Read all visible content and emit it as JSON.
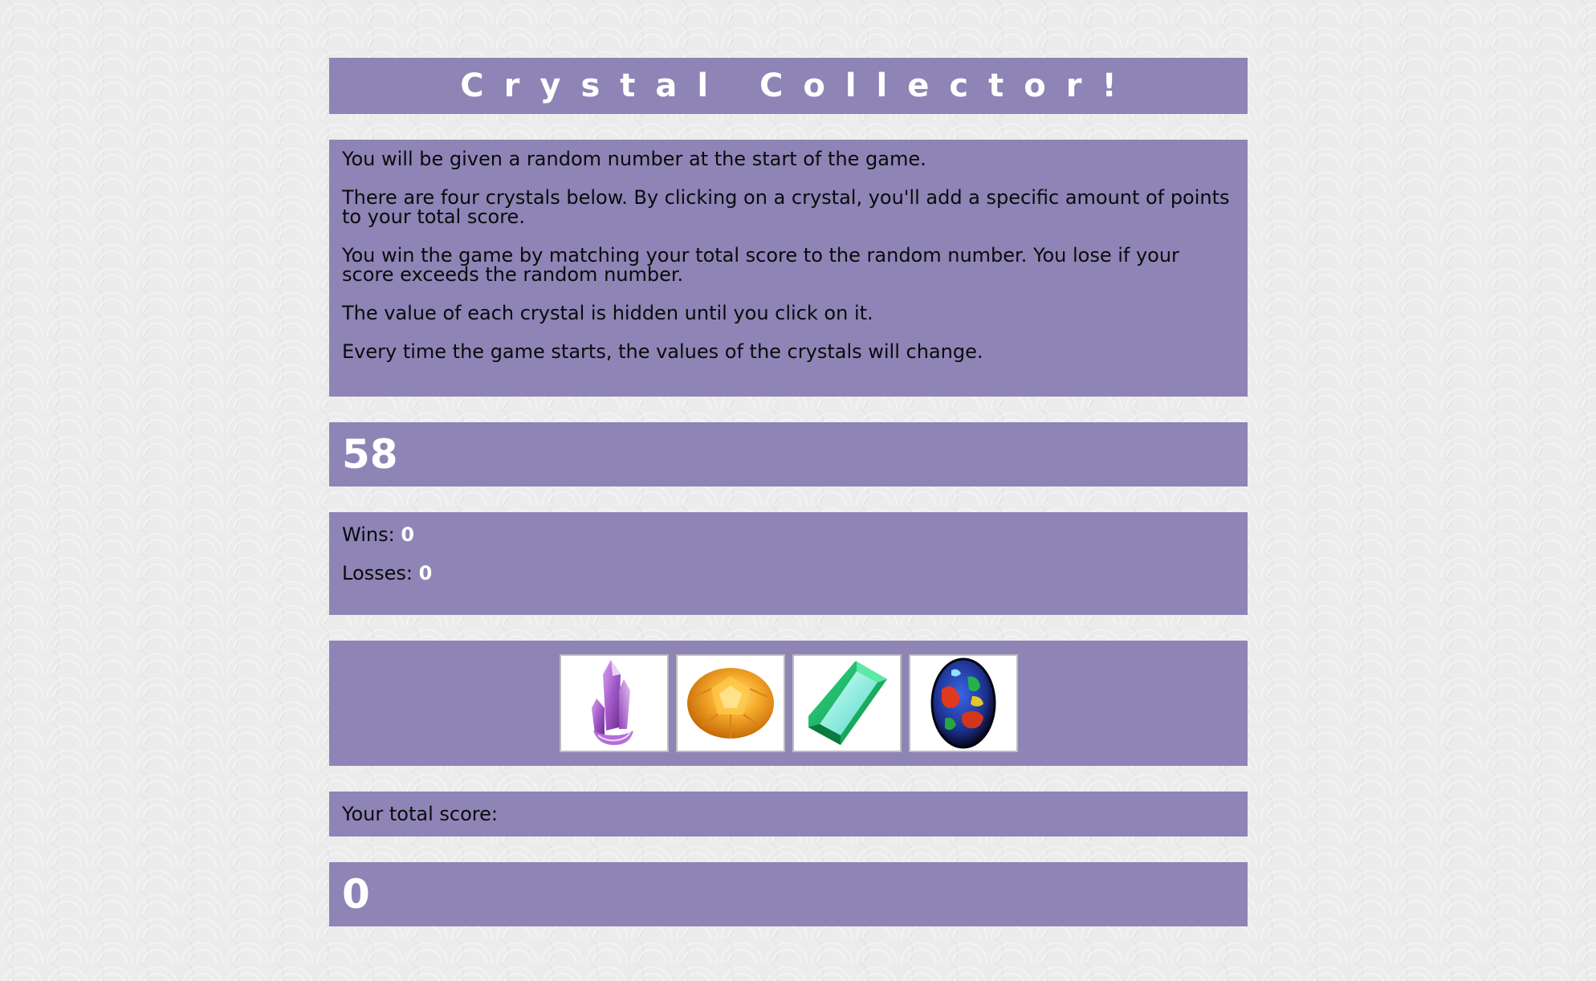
{
  "title": "Crystal Collector!",
  "instructions": [
    "You will be given a random number at the start of the game.",
    "There are four crystals below. By clicking on a crystal, you'll add a specific amount of points to your total score.",
    "You win the game by matching your total score to the random number. You lose if your score exceeds the random number.",
    "The value of each crystal is hidden until you click on it.",
    "Every time the game starts, the values of the crystals will change."
  ],
  "target_number": "58",
  "stats": {
    "wins_label": "Wins:",
    "wins_value": "0",
    "losses_label": "Losses:",
    "losses_value": "0"
  },
  "crystals": [
    {
      "icon": "purple-crystal-icon",
      "color": "#a35ac9"
    },
    {
      "icon": "orange-gem-icon",
      "color": "#f39a1c"
    },
    {
      "icon": "green-emerald-icon",
      "color": "#1fbf6a"
    },
    {
      "icon": "opal-gem-icon",
      "color": "#1f3fb0"
    }
  ],
  "score": {
    "label": "Your total score:",
    "value": "0"
  },
  "colors": {
    "panel": "#8e84b6",
    "accent_text": "#ffffff"
  }
}
